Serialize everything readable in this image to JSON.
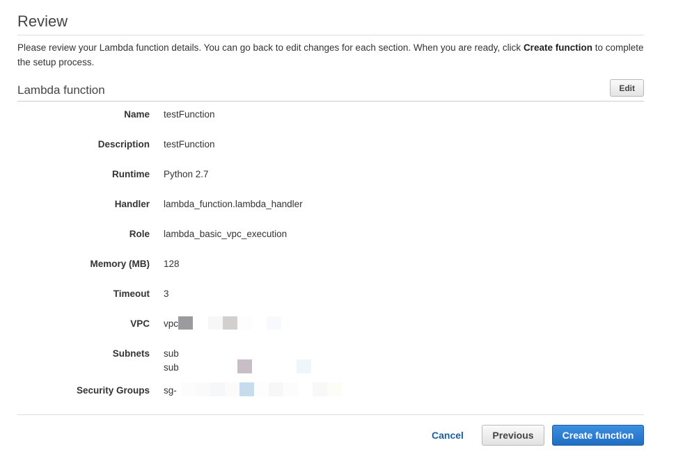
{
  "review": {
    "title": "Review",
    "intro_before": "Please review your Lambda function details. You can go back to edit changes for each section. When you are ready, click ",
    "intro_bold": "Create function",
    "intro_after": " to complete the setup process."
  },
  "section": {
    "title": "Lambda function",
    "edit_label": "Edit"
  },
  "fields": {
    "name": {
      "label": "Name",
      "value": "testFunction"
    },
    "description": {
      "label": "Description",
      "value": "testFunction"
    },
    "runtime": {
      "label": "Runtime",
      "value": "Python 2.7"
    },
    "handler": {
      "label": "Handler",
      "value": "lambda_function.lambda_handler"
    },
    "role": {
      "label": "Role",
      "value": "lambda_basic_vpc_execution"
    },
    "memory": {
      "label": "Memory (MB)",
      "value": "128"
    },
    "timeout": {
      "label": "Timeout",
      "value": "3"
    },
    "vpc": {
      "label": "VPC",
      "value": "vpc"
    },
    "subnets": {
      "label": "Subnets",
      "value1": "sub",
      "value2": "sub"
    },
    "security_groups": {
      "label": "Security Groups",
      "value": "sg-"
    }
  },
  "footer": {
    "cancel_label": "Cancel",
    "previous_label": "Previous",
    "create_label": "Create function"
  },
  "colors": {
    "primary_button": "#1f6ec5",
    "link": "#1a5ea6"
  }
}
